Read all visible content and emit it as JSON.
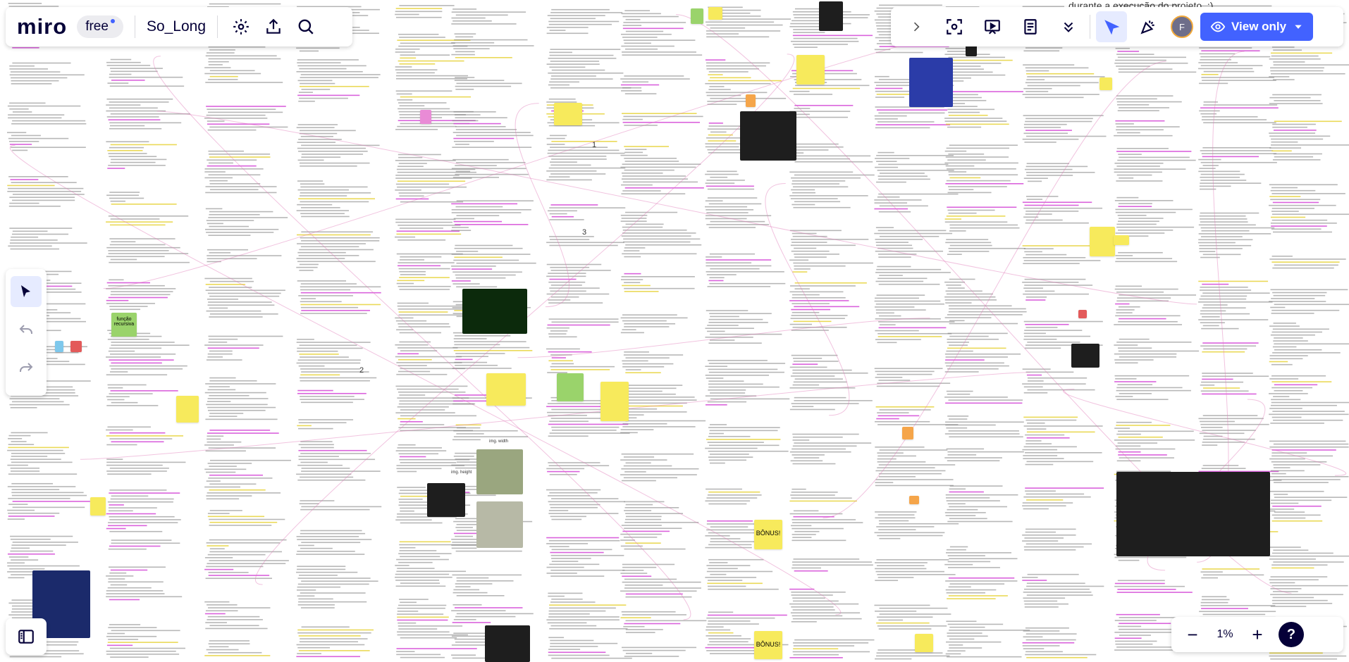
{
  "app": {
    "logo": "miro",
    "plan_badge": "free",
    "board_name": "So_Long"
  },
  "topbar_left": {
    "icons": [
      "gear-icon",
      "share-upload-icon",
      "search-icon"
    ]
  },
  "topbar_right": {
    "icons": [
      "chevron-right-icon",
      "focus-frame-icon",
      "presentation-icon",
      "notes-icon",
      "more-chevron-icon",
      "cursor-pointer-icon",
      "party-reaction-icon"
    ],
    "avatar_initial": "F",
    "view_button_label": "View only",
    "view_button_icon": "eye-icon",
    "accent": "#4262ff"
  },
  "left_toolbar": {
    "tools": [
      "select-cursor-icon",
      "undo-icon",
      "redo-icon"
    ]
  },
  "bottom": {
    "panel_icon": "side-panel-icon",
    "zoom_out": "−",
    "zoom_level": "1%",
    "zoom_in": "+",
    "help": "?"
  },
  "canvas": {
    "top_caption": "durante a execução do projeto. :)",
    "stickies": [
      {
        "text": "função recursiva"
      },
      {
        "text": "BÔNUS!"
      },
      {
        "text": "BÔNUS!"
      },
      {
        "text": "img. width"
      },
      {
        "text": "img. height"
      }
    ],
    "section_numbers": [
      "1",
      "2",
      "3"
    ]
  }
}
